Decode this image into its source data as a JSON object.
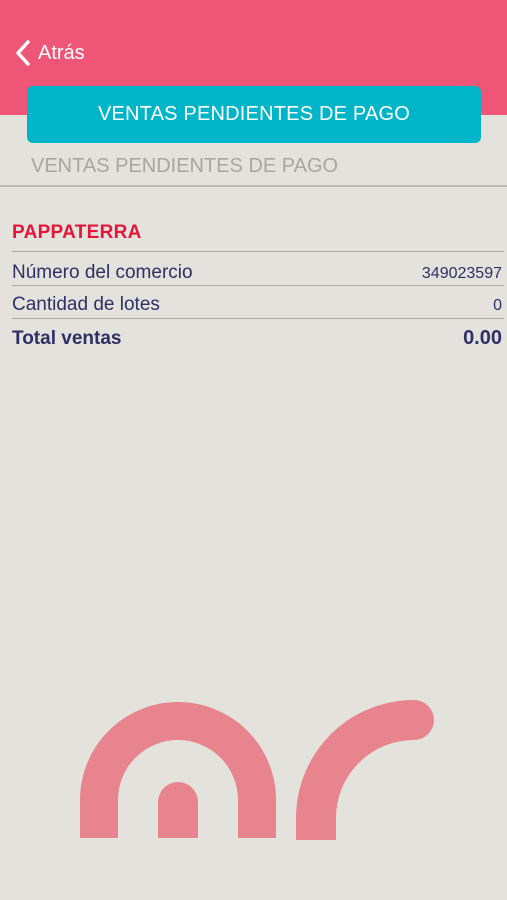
{
  "header": {
    "back_label": "Atrás",
    "primary_button_label": "VENTAS PENDIENTES DE PAGO",
    "subtitle": "VENTAS PENDIENTES DE PAGO"
  },
  "merchant": {
    "name": "PAPPATERRA",
    "rows": [
      {
        "label": "Número del comercio",
        "value": "349023597"
      },
      {
        "label": "Cantidad de lotes",
        "value": "0"
      }
    ],
    "total": {
      "label": "Total ventas",
      "value": "0.00"
    }
  },
  "colors": {
    "header_bg": "#ef5576",
    "button_bg": "#00b5c8",
    "merchant_name": "#e5163a",
    "row_text": "#2e2f64",
    "logo": "#e8848d"
  },
  "icons": {
    "back": "chevron-left-icon",
    "brand": "brand-logo-icon"
  }
}
